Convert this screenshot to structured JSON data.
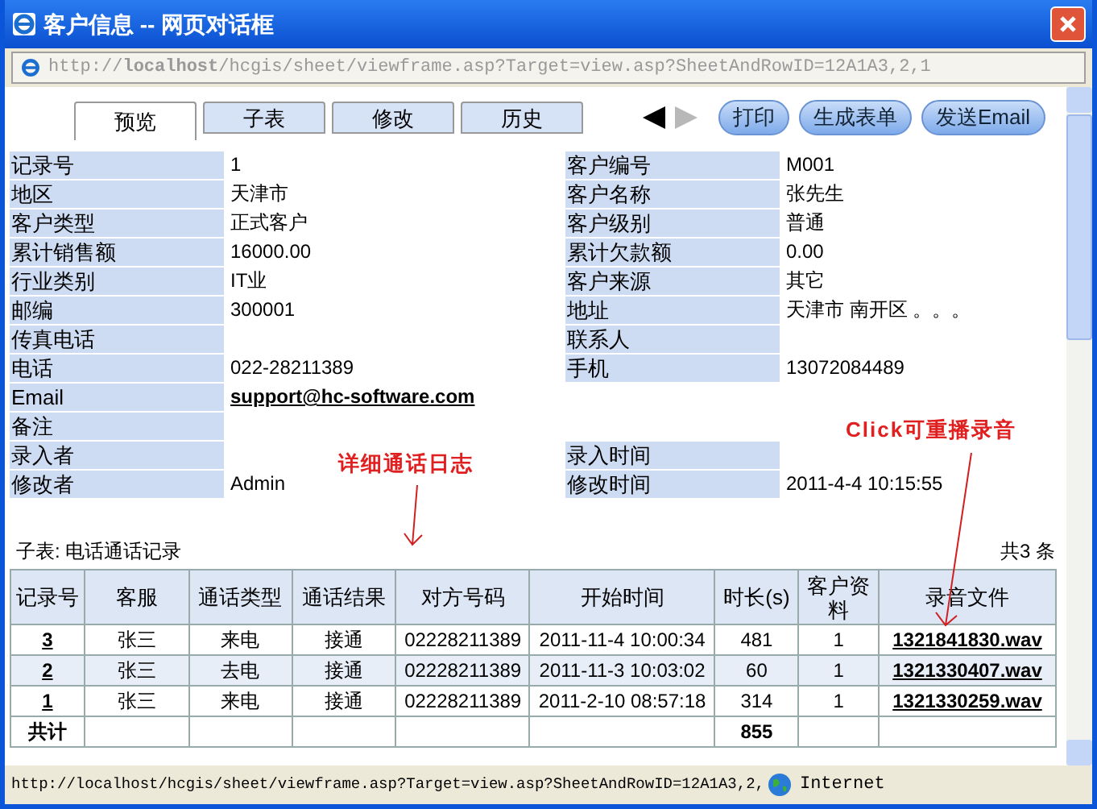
{
  "window": {
    "title": "客户信息 -- 网页对话框"
  },
  "address_bar": {
    "url": "http://**localhost**/hcgis/sheet/viewframe.asp?Target=view.asp?SheetAndRowID=12A1A3,2,1"
  },
  "tabs": [
    {
      "label": "预览",
      "selected": true
    },
    {
      "label": "子表",
      "selected": false
    },
    {
      "label": "修改",
      "selected": false
    },
    {
      "label": "历史",
      "selected": false
    }
  ],
  "nav": [
    {
      "kind": "prev",
      "disabled": false
    },
    {
      "kind": "next",
      "disabled": true
    }
  ],
  "buttons": [
    "打印",
    "生成表单",
    "发送Email"
  ],
  "form_rows": [
    {
      "left": {
        "label": "记录号",
        "value": "1"
      },
      "right": {
        "label": "客户编号",
        "value": "M001"
      }
    },
    {
      "left": {
        "label": "地区",
        "value": "天津市"
      },
      "right": {
        "label": "客户名称",
        "value": "张先生"
      }
    },
    {
      "left": {
        "label": "客户类型",
        "value": "正式客户"
      },
      "right": {
        "label": "客户级别",
        "value": "普通"
      }
    },
    {
      "left": {
        "label": "累计销售额",
        "value": "16000.00"
      },
      "right": {
        "label": "累计欠款额",
        "value": "0.00"
      }
    },
    {
      "left": {
        "label": "行业类别",
        "value": "IT业"
      },
      "right": {
        "label": "客户来源",
        "value": "其它"
      }
    },
    {
      "left": {
        "label": "邮编",
        "value": "300001"
      },
      "right": {
        "label": "地址",
        "value": "天津市 南开区 。。。"
      }
    },
    {
      "left": {
        "label": "传真电话"
      },
      "right": {
        "label": "联系人"
      }
    },
    {
      "left": {
        "label": "电话",
        "value": "022-28211389"
      },
      "right": {
        "label": "手机",
        "value": "13072084489"
      }
    },
    {
      "left": {
        "label": "Email",
        "value": "support@hc-software.com",
        "kind": "link"
      }
    },
    {
      "left": {
        "label": "备注"
      }
    },
    {
      "left": {
        "label": "录入者"
      },
      "right": {
        "label": "录入时间"
      }
    },
    {
      "left": {
        "label": "修改者",
        "value": "Admin"
      },
      "right": {
        "label": "修改时间",
        "value": "2011-4-4 10:15:55"
      }
    }
  ],
  "annotations": [
    {
      "text": "详细通话日志"
    },
    {
      "text": "Click可重播录音"
    }
  ],
  "subtable": {
    "title": "子表: 电话通话记录",
    "count": "共3 条",
    "columns": [
      "记录号",
      "客服",
      "通话类型",
      "通话结果",
      "对方号码",
      "开始时间",
      "时长(s)",
      "客户资料",
      "录音文件"
    ],
    "rows": [
      {
        "cells": [
          "3",
          "张三",
          "来电",
          "接通",
          "02228211389",
          "2011-11-4 10:00:34",
          "481",
          "1",
          "1321841830.wav"
        ]
      },
      {
        "cells": [
          "2",
          "张三",
          "去电",
          "接通",
          "02228211389",
          "2011-11-3 10:03:02",
          "60",
          "1",
          "1321330407.wav"
        ]
      },
      {
        "cells": [
          "1",
          "张三",
          "来电",
          "接通",
          "02228211389",
          "2011-2-10 08:57:18",
          "314",
          "1",
          "1321330259.wav"
        ]
      }
    ],
    "total": {
      "label": "共计",
      "duration": "855"
    }
  },
  "status_bar": {
    "url": "http://localhost/hcgis/sheet/viewframe.asp?Target=view.asp?SheetAndRowID=12A1A3,2,",
    "zone": "Internet"
  }
}
